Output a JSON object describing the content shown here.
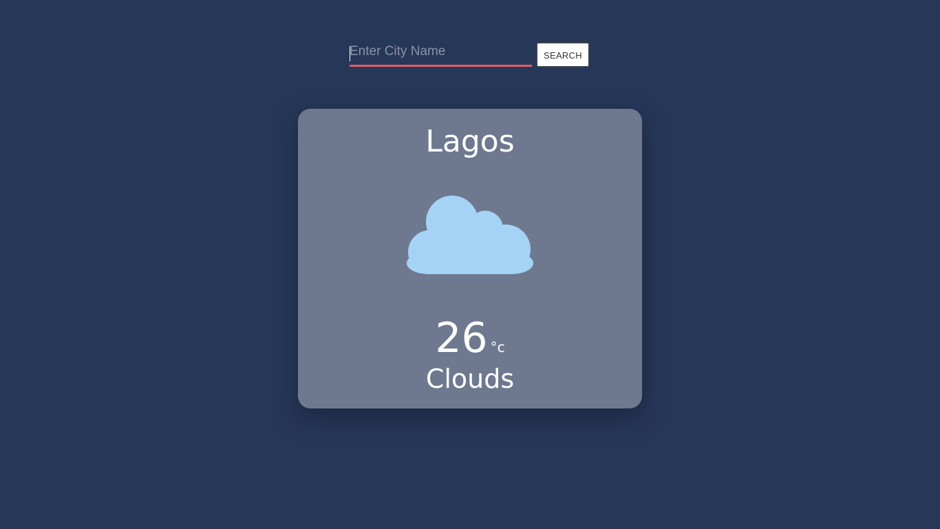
{
  "search": {
    "placeholder": "Enter City Name",
    "value": "",
    "button_label": "SEARCH",
    "accent_color": "#e35b66"
  },
  "weather": {
    "city": "Lagos",
    "icon": "cloud-icon",
    "icon_color": "#a5d3f6",
    "temperature": "26",
    "unit": "°c",
    "condition": "Clouds"
  },
  "colors": {
    "background": "#273758",
    "card": "#6e798f"
  }
}
